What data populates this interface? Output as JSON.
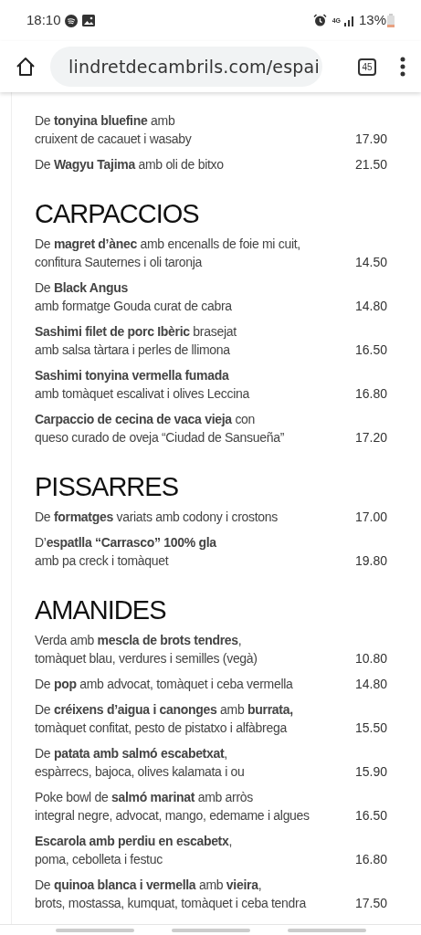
{
  "status_bar": {
    "time": "18:10",
    "network": "4G",
    "battery": "13%"
  },
  "browser": {
    "url": "lindretdecambrils.com/espai",
    "tab_count": "45"
  },
  "lead_items": [
    {
      "line1": "De **tonyina bluefine** amb",
      "line2": "cruixent de cacauet i wasaby",
      "price": "17.90"
    },
    {
      "line1": "De **Wagyu Tajima** amb oli de bitxo",
      "price": "21.50"
    }
  ],
  "sections": [
    {
      "title": "CARPACCIOS",
      "items": [
        {
          "line1": "De **magret d’ànec** amb encenalls de foie mi cuit,",
          "line2": "confitura Sauternes i oli taronja",
          "price": "14.50"
        },
        {
          "line1": "De **Black Angus**",
          "line2": "amb formatge Gouda curat de cabra",
          "price": "14.80"
        },
        {
          "line1": "**Sashimi filet de porc Ibèric** brasejat",
          "line2": "amb salsa tàrtara i perles de llimona",
          "price": "16.50"
        },
        {
          "line1": "**Sashimi tonyina vermella fumada**",
          "line2": "amb tomàquet escalivat i olives Leccina",
          "price": "16.80"
        },
        {
          "line1": "**Carpaccio de cecina de vaca vieja** con",
          "line2": "queso curado de oveja “Ciudad de Sansueña”",
          "price": "17.20"
        }
      ]
    },
    {
      "title": "PISSARRES",
      "items": [
        {
          "line1": "De **formatges** variats amb codony i crostons",
          "price": "17.00"
        },
        {
          "line1": "D’**espatlla “Carrasco” 100% gla**",
          "line2": "amb pa creck i tomàquet",
          "price": "19.80"
        }
      ]
    },
    {
      "title": "AMANIDES",
      "items": [
        {
          "line1": "Verda amb **mescla de brots tendres**,",
          "line2": "tomàquet blau, verdures i semilles (vegà)",
          "price": "10.80"
        },
        {
          "line1": "De **pop** amb advocat, tomàquet i ceba vermella",
          "price": "14.80"
        },
        {
          "line1": "De **créixens d’aigua i canonges** amb **burrata,**",
          "line2": "tomàquet confitat, pesto de pistatxo i alfàbrega",
          "price": "15.50"
        },
        {
          "line1": "De **patata amb salmó escabetxat**,",
          "line2": "espàrrecs, bajoca, olives kalamata i ou",
          "price": "15.90"
        },
        {
          "line1": "Poke bowl de **salmó marinat** amb arròs",
          "line2": "integral negre, advocat, mango, edemame i algues",
          "price": "16.50"
        },
        {
          "line1": "**Escarola amb perdiu en escabetx**,",
          "line2": "poma, cebolleta i festuc",
          "price": "16.80"
        },
        {
          "line1": "De **quinoa blanca i vermella** amb **vieira**,",
          "line2": "brots, mostassa, kumquat, tomàquet i ceba tendra",
          "price": "17.50"
        }
      ]
    }
  ]
}
